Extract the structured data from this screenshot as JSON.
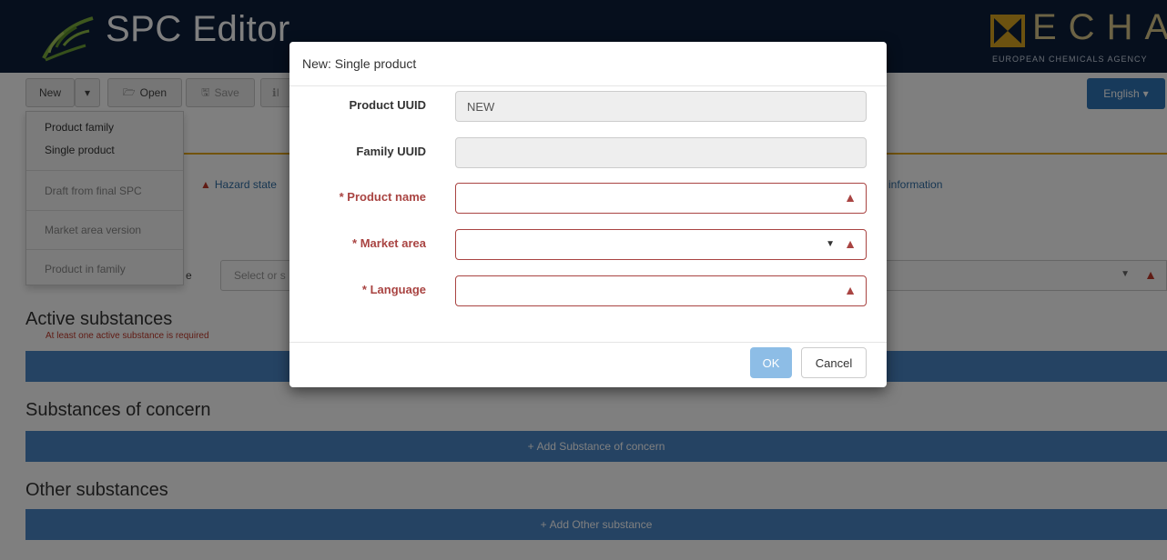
{
  "app": {
    "title": "SPC Editor",
    "brand": "ECHA",
    "brand_subtitle": "EUROPEAN CHEMICALS AGENCY"
  },
  "toolbar": {
    "new_label": "New",
    "open_label": "Open",
    "save_label": "Save",
    "info_label": "I",
    "language_label": "English",
    "caret_glyph": "▾"
  },
  "new_menu": {
    "items": [
      {
        "label": "Product family",
        "enabled": true
      },
      {
        "label": "Single product",
        "enabled": true
      },
      {
        "label": "Draft from final SPC",
        "enabled": false
      },
      {
        "label": "Market area version",
        "enabled": false
      },
      {
        "label": "Product in family",
        "enabled": false
      }
    ]
  },
  "background": {
    "tab_hazard": "Hazard state",
    "tab_information": "information",
    "type_label_fragment": "e",
    "select_placeholder_fragment": "Select or s",
    "sections": [
      {
        "title": "Active substances",
        "message": "At least one active substance is required",
        "add_label": ""
      },
      {
        "title": "Substances of concern",
        "message": "",
        "add_label": "Add Substance of concern"
      },
      {
        "title": "Other substances",
        "message": "",
        "add_label": "Add Other substance"
      }
    ]
  },
  "modal": {
    "title": "New: Single product",
    "fields": [
      {
        "label": "Product UUID",
        "value": "NEW",
        "required": false,
        "readonly": true
      },
      {
        "label": "Family UUID",
        "value": "",
        "required": false,
        "readonly": true
      },
      {
        "label": "* Product name",
        "value": "",
        "required": true,
        "readonly": false
      },
      {
        "label": "* Market area",
        "value": "",
        "required": true,
        "readonly": false,
        "type": "select"
      },
      {
        "label": "* Language",
        "value": "",
        "required": true,
        "readonly": false,
        "type": "select"
      }
    ],
    "ok_label": "OK",
    "cancel_label": "Cancel"
  },
  "colors": {
    "header_bg": "#0d1f3a",
    "accent_blue": "#2e75b6",
    "error_red": "#a94442",
    "orange_rule": "#e5a617",
    "echa_gold": "#d9c68a"
  }
}
